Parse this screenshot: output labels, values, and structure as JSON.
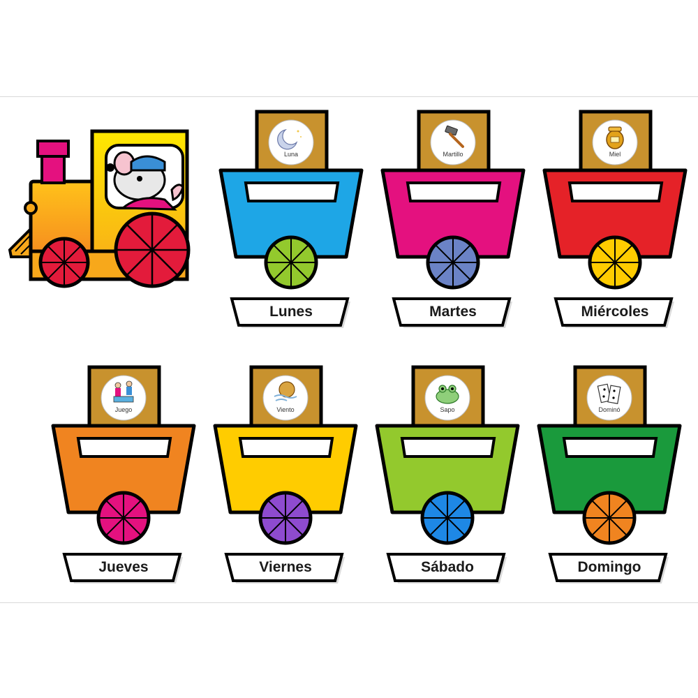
{
  "cars": [
    {
      "day": "Lunes",
      "picture": "Luna",
      "icon": "moon-icon",
      "body_color": "#1ea6e6",
      "wheel_color": "#93c92d"
    },
    {
      "day": "Martes",
      "picture": "Martillo",
      "icon": "hammer-icon",
      "body_color": "#e4117f",
      "wheel_color": "#6b83c6"
    },
    {
      "day": "Miércoles",
      "picture": "Miel",
      "icon": "honey-pot-icon",
      "body_color": "#e52228",
      "wheel_color": "#ffcc00"
    },
    {
      "day": "Jueves",
      "picture": "Juego",
      "icon": "children-playing-icon",
      "body_color": "#f08420",
      "wheel_color": "#e4117f"
    },
    {
      "day": "Viernes",
      "picture": "Viento",
      "icon": "wind-icon",
      "body_color": "#ffcc00",
      "wheel_color": "#8e4bcf"
    },
    {
      "day": "Sábado",
      "picture": "Sapo",
      "icon": "frog-icon",
      "body_color": "#93c92d",
      "wheel_color": "#1e88e5"
    },
    {
      "day": "Domingo",
      "picture": "Dominó",
      "icon": "domino-icon",
      "body_color": "#1a9a3c",
      "wheel_color": "#f08420"
    }
  ],
  "engine": {
    "icon": "mouse-driver-icon",
    "body_color": "#f7a81b",
    "wheel_color": "#e31b3b",
    "chimney_color": "#e4117f",
    "cab_color": "#ffe100"
  },
  "colors": {
    "outline": "#000000",
    "tag_color": "#c8922e"
  }
}
